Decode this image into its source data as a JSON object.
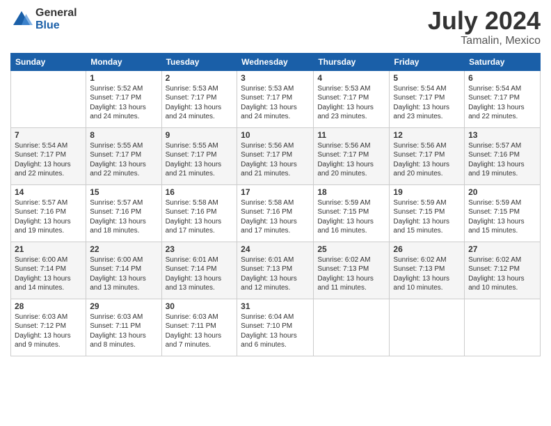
{
  "header": {
    "logo_general": "General",
    "logo_blue": "Blue",
    "title": "July 2024",
    "location": "Tamalin, Mexico"
  },
  "weekdays": [
    "Sunday",
    "Monday",
    "Tuesday",
    "Wednesday",
    "Thursday",
    "Friday",
    "Saturday"
  ],
  "weeks": [
    [
      {
        "day": "",
        "sunrise": "",
        "sunset": "",
        "daylight": ""
      },
      {
        "day": "1",
        "sunrise": "Sunrise: 5:52 AM",
        "sunset": "Sunset: 7:17 PM",
        "daylight": "Daylight: 13 hours and 24 minutes."
      },
      {
        "day": "2",
        "sunrise": "Sunrise: 5:53 AM",
        "sunset": "Sunset: 7:17 PM",
        "daylight": "Daylight: 13 hours and 24 minutes."
      },
      {
        "day": "3",
        "sunrise": "Sunrise: 5:53 AM",
        "sunset": "Sunset: 7:17 PM",
        "daylight": "Daylight: 13 hours and 24 minutes."
      },
      {
        "day": "4",
        "sunrise": "Sunrise: 5:53 AM",
        "sunset": "Sunset: 7:17 PM",
        "daylight": "Daylight: 13 hours and 23 minutes."
      },
      {
        "day": "5",
        "sunrise": "Sunrise: 5:54 AM",
        "sunset": "Sunset: 7:17 PM",
        "daylight": "Daylight: 13 hours and 23 minutes."
      },
      {
        "day": "6",
        "sunrise": "Sunrise: 5:54 AM",
        "sunset": "Sunset: 7:17 PM",
        "daylight": "Daylight: 13 hours and 22 minutes."
      }
    ],
    [
      {
        "day": "7",
        "sunrise": "Sunrise: 5:54 AM",
        "sunset": "Sunset: 7:17 PM",
        "daylight": "Daylight: 13 hours and 22 minutes."
      },
      {
        "day": "8",
        "sunrise": "Sunrise: 5:55 AM",
        "sunset": "Sunset: 7:17 PM",
        "daylight": "Daylight: 13 hours and 22 minutes."
      },
      {
        "day": "9",
        "sunrise": "Sunrise: 5:55 AM",
        "sunset": "Sunset: 7:17 PM",
        "daylight": "Daylight: 13 hours and 21 minutes."
      },
      {
        "day": "10",
        "sunrise": "Sunrise: 5:56 AM",
        "sunset": "Sunset: 7:17 PM",
        "daylight": "Daylight: 13 hours and 21 minutes."
      },
      {
        "day": "11",
        "sunrise": "Sunrise: 5:56 AM",
        "sunset": "Sunset: 7:17 PM",
        "daylight": "Daylight: 13 hours and 20 minutes."
      },
      {
        "day": "12",
        "sunrise": "Sunrise: 5:56 AM",
        "sunset": "Sunset: 7:17 PM",
        "daylight": "Daylight: 13 hours and 20 minutes."
      },
      {
        "day": "13",
        "sunrise": "Sunrise: 5:57 AM",
        "sunset": "Sunset: 7:16 PM",
        "daylight": "Daylight: 13 hours and 19 minutes."
      }
    ],
    [
      {
        "day": "14",
        "sunrise": "Sunrise: 5:57 AM",
        "sunset": "Sunset: 7:16 PM",
        "daylight": "Daylight: 13 hours and 19 minutes."
      },
      {
        "day": "15",
        "sunrise": "Sunrise: 5:57 AM",
        "sunset": "Sunset: 7:16 PM",
        "daylight": "Daylight: 13 hours and 18 minutes."
      },
      {
        "day": "16",
        "sunrise": "Sunrise: 5:58 AM",
        "sunset": "Sunset: 7:16 PM",
        "daylight": "Daylight: 13 hours and 17 minutes."
      },
      {
        "day": "17",
        "sunrise": "Sunrise: 5:58 AM",
        "sunset": "Sunset: 7:16 PM",
        "daylight": "Daylight: 13 hours and 17 minutes."
      },
      {
        "day": "18",
        "sunrise": "Sunrise: 5:59 AM",
        "sunset": "Sunset: 7:15 PM",
        "daylight": "Daylight: 13 hours and 16 minutes."
      },
      {
        "day": "19",
        "sunrise": "Sunrise: 5:59 AM",
        "sunset": "Sunset: 7:15 PM",
        "daylight": "Daylight: 13 hours and 15 minutes."
      },
      {
        "day": "20",
        "sunrise": "Sunrise: 5:59 AM",
        "sunset": "Sunset: 7:15 PM",
        "daylight": "Daylight: 13 hours and 15 minutes."
      }
    ],
    [
      {
        "day": "21",
        "sunrise": "Sunrise: 6:00 AM",
        "sunset": "Sunset: 7:14 PM",
        "daylight": "Daylight: 13 hours and 14 minutes."
      },
      {
        "day": "22",
        "sunrise": "Sunrise: 6:00 AM",
        "sunset": "Sunset: 7:14 PM",
        "daylight": "Daylight: 13 hours and 13 minutes."
      },
      {
        "day": "23",
        "sunrise": "Sunrise: 6:01 AM",
        "sunset": "Sunset: 7:14 PM",
        "daylight": "Daylight: 13 hours and 13 minutes."
      },
      {
        "day": "24",
        "sunrise": "Sunrise: 6:01 AM",
        "sunset": "Sunset: 7:13 PM",
        "daylight": "Daylight: 13 hours and 12 minutes."
      },
      {
        "day": "25",
        "sunrise": "Sunrise: 6:02 AM",
        "sunset": "Sunset: 7:13 PM",
        "daylight": "Daylight: 13 hours and 11 minutes."
      },
      {
        "day": "26",
        "sunrise": "Sunrise: 6:02 AM",
        "sunset": "Sunset: 7:13 PM",
        "daylight": "Daylight: 13 hours and 10 minutes."
      },
      {
        "day": "27",
        "sunrise": "Sunrise: 6:02 AM",
        "sunset": "Sunset: 7:12 PM",
        "daylight": "Daylight: 13 hours and 10 minutes."
      }
    ],
    [
      {
        "day": "28",
        "sunrise": "Sunrise: 6:03 AM",
        "sunset": "Sunset: 7:12 PM",
        "daylight": "Daylight: 13 hours and 9 minutes."
      },
      {
        "day": "29",
        "sunrise": "Sunrise: 6:03 AM",
        "sunset": "Sunset: 7:11 PM",
        "daylight": "Daylight: 13 hours and 8 minutes."
      },
      {
        "day": "30",
        "sunrise": "Sunrise: 6:03 AM",
        "sunset": "Sunset: 7:11 PM",
        "daylight": "Daylight: 13 hours and 7 minutes."
      },
      {
        "day": "31",
        "sunrise": "Sunrise: 6:04 AM",
        "sunset": "Sunset: 7:10 PM",
        "daylight": "Daylight: 13 hours and 6 minutes."
      },
      {
        "day": "",
        "sunrise": "",
        "sunset": "",
        "daylight": ""
      },
      {
        "day": "",
        "sunrise": "",
        "sunset": "",
        "daylight": ""
      },
      {
        "day": "",
        "sunrise": "",
        "sunset": "",
        "daylight": ""
      }
    ]
  ]
}
